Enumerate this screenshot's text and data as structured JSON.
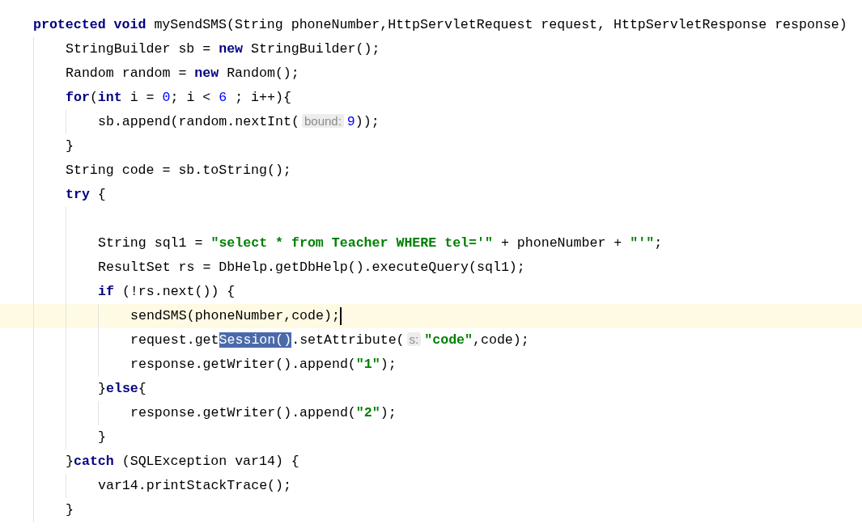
{
  "editor": {
    "lines": [
      {
        "current": false,
        "tokens": [
          {
            "kind": "keyword",
            "text": "protected "
          },
          {
            "kind": "keyword",
            "text": "void"
          },
          {
            "kind": "plain",
            "text": " mySendSMS(String phoneNumber,HttpServletRequest request, HttpServletResponse response)"
          }
        ],
        "children": [
          {
            "current": false,
            "tokens": [
              {
                "kind": "plain",
                "text": "StringBuilder sb = "
              },
              {
                "kind": "keyword",
                "text": "new"
              },
              {
                "kind": "plain",
                "text": " StringBuilder();"
              }
            ]
          },
          {
            "current": false,
            "tokens": [
              {
                "kind": "plain",
                "text": "Random random = "
              },
              {
                "kind": "keyword",
                "text": "new"
              },
              {
                "kind": "plain",
                "text": " Random();"
              }
            ]
          },
          {
            "current": false,
            "tokens": [
              {
                "kind": "keyword",
                "text": "for"
              },
              {
                "kind": "plain",
                "text": "("
              },
              {
                "kind": "keyword",
                "text": "int"
              },
              {
                "kind": "plain",
                "text": " i = "
              },
              {
                "kind": "number",
                "text": "0"
              },
              {
                "kind": "plain",
                "text": "; i < "
              },
              {
                "kind": "number",
                "text": "6"
              },
              {
                "kind": "plain",
                "text": " ; i++){"
              }
            ],
            "children": [
              {
                "current": false,
                "tokens": [
                  {
                    "kind": "plain",
                    "text": "sb.append(random.nextInt("
                  },
                  {
                    "kind": "hint",
                    "text": "bound:"
                  },
                  {
                    "kind": "number",
                    "text": "9"
                  },
                  {
                    "kind": "plain",
                    "text": "));"
                  }
                ]
              }
            ]
          },
          {
            "current": false,
            "tokens": [
              {
                "kind": "plain",
                "text": "}"
              }
            ]
          },
          {
            "current": false,
            "tokens": [
              {
                "kind": "plain",
                "text": "String code = sb.toString();"
              }
            ]
          },
          {
            "current": false,
            "tokens": [
              {
                "kind": "keyword",
                "text": "try"
              },
              {
                "kind": "plain",
                "text": " {"
              }
            ],
            "children": [
              {
                "current": false
              },
              {
                "current": false,
                "tokens": [
                  {
                    "kind": "plain",
                    "text": "String sql1 = "
                  },
                  {
                    "kind": "string",
                    "text": "\"select * from Teacher WHERE tel='\""
                  },
                  {
                    "kind": "plain",
                    "text": " + phoneNumber + "
                  },
                  {
                    "kind": "string",
                    "text": "\"'\""
                  },
                  {
                    "kind": "plain",
                    "text": ";"
                  }
                ]
              },
              {
                "current": false,
                "tokens": [
                  {
                    "kind": "plain",
                    "text": "ResultSet rs = DbHelp.getDbHelp().executeQuery(sql1);"
                  }
                ]
              },
              {
                "current": false,
                "tokens": [
                  {
                    "kind": "keyword",
                    "text": "if"
                  },
                  {
                    "kind": "plain",
                    "text": " (!rs.next()) {"
                  }
                ],
                "children": [
                  {
                    "current": true,
                    "tokens": [
                      {
                        "kind": "plain",
                        "text": "sendSMS(phoneNumber,code);"
                      }
                    ]
                  },
                  {
                    "current": false,
                    "tokens": [
                      {
                        "kind": "plain",
                        "text": "request.get"
                      },
                      {
                        "kind": "selected",
                        "text": "Session()"
                      },
                      {
                        "kind": "plain",
                        "text": ".setAttribute("
                      },
                      {
                        "kind": "hint",
                        "text": "s:"
                      },
                      {
                        "kind": "string",
                        "text": "\"code\""
                      },
                      {
                        "kind": "plain",
                        "text": ",code);"
                      }
                    ]
                  },
                  {
                    "current": false,
                    "tokens": [
                      {
                        "kind": "plain",
                        "text": "response.getWriter().append("
                      },
                      {
                        "kind": "string",
                        "text": "\"1\""
                      },
                      {
                        "kind": "plain",
                        "text": ");"
                      }
                    ]
                  }
                ]
              },
              {
                "current": false,
                "tokens": [
                  {
                    "kind": "plain",
                    "text": "}"
                  },
                  {
                    "kind": "keyword",
                    "text": "else"
                  },
                  {
                    "kind": "plain",
                    "text": "{"
                  }
                ],
                "children": [
                  {
                    "current": false,
                    "tokens": [
                      {
                        "kind": "plain",
                        "text": "response.getWriter().append("
                      },
                      {
                        "kind": "string",
                        "text": "\"2\""
                      },
                      {
                        "kind": "plain",
                        "text": ");"
                      }
                    ]
                  }
                ]
              },
              {
                "current": false,
                "tokens": [
                  {
                    "kind": "plain",
                    "text": "}"
                  }
                ]
              }
            ]
          },
          {
            "current": false,
            "tokens": [
              {
                "kind": "plain",
                "text": "}"
              },
              {
                "kind": "keyword",
                "text": "catch"
              },
              {
                "kind": "plain",
                "text": " (SQLException var14) {"
              }
            ],
            "children": [
              {
                "current": false,
                "tokens": [
                  {
                    "kind": "plain",
                    "text": "var14.printStackTrace();"
                  }
                ]
              }
            ]
          },
          {
            "current": false,
            "tokens": [
              {
                "kind": "plain",
                "text": "}"
              }
            ]
          }
        ]
      }
    ]
  }
}
